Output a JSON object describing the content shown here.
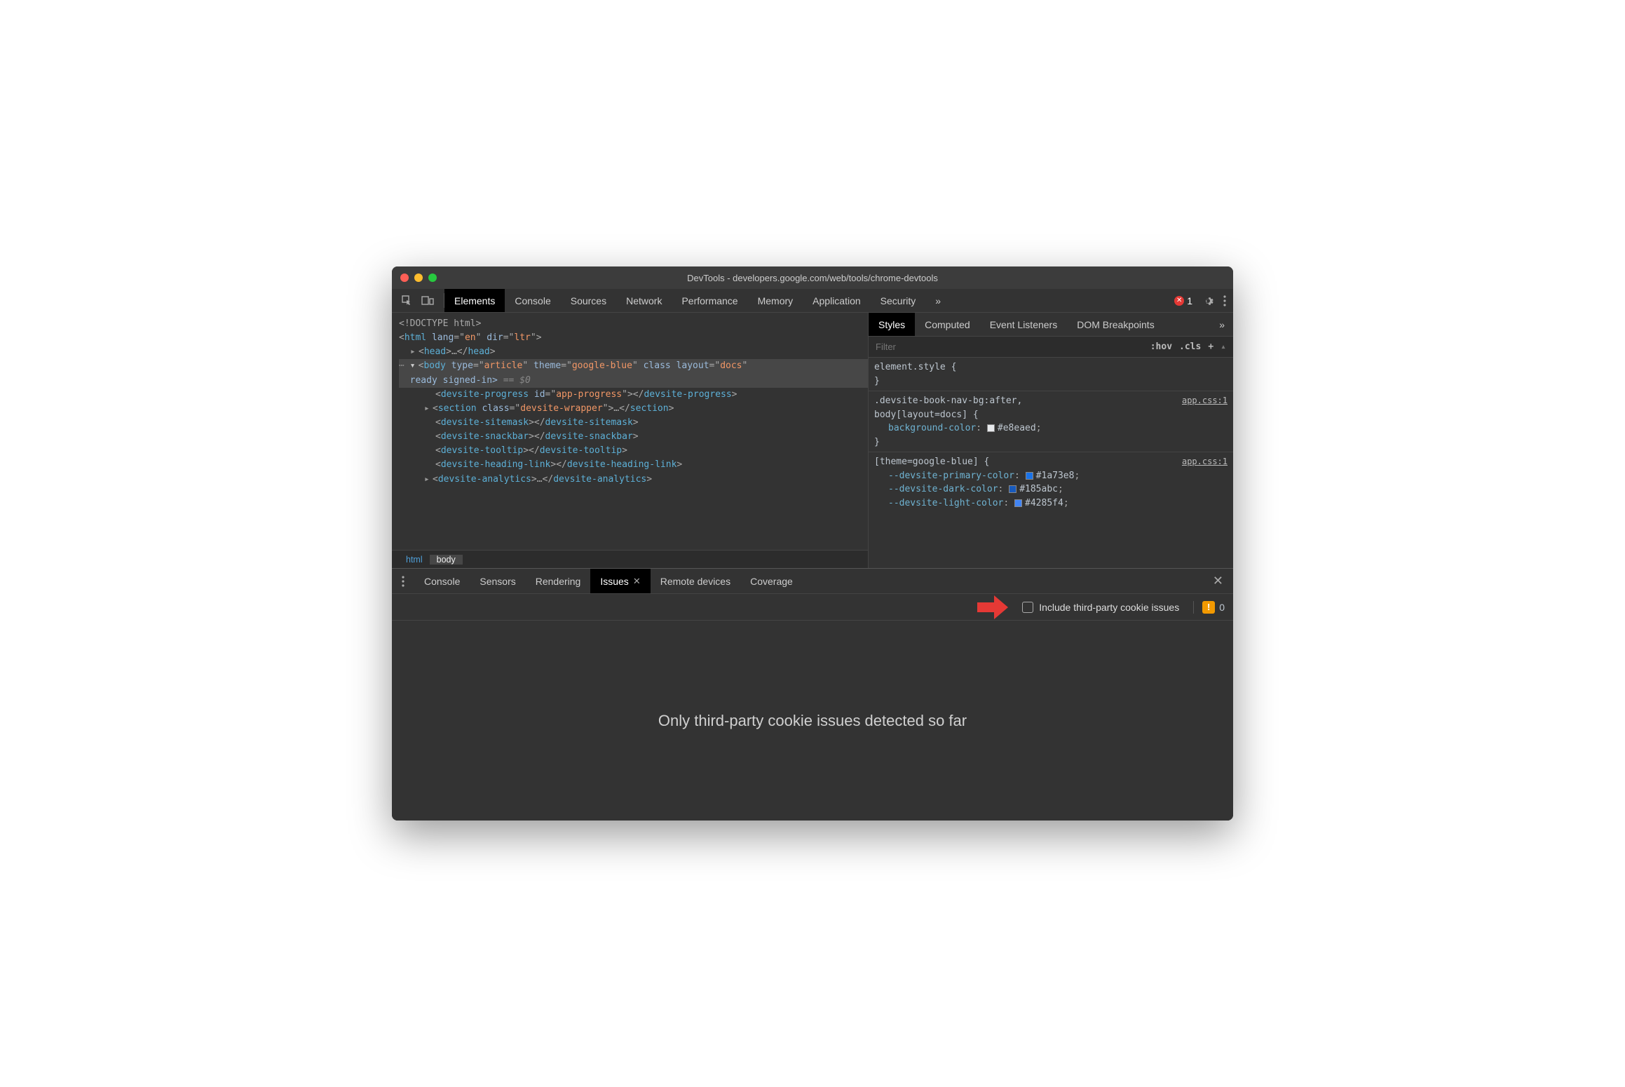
{
  "title": "DevTools - developers.google.com/web/tools/chrome-devtools",
  "toolbar": {
    "tabs": [
      "Elements",
      "Console",
      "Sources",
      "Network",
      "Performance",
      "Memory",
      "Application",
      "Security"
    ],
    "activeTab": "Elements",
    "errorCount": "1"
  },
  "dom": {
    "doctype": "<!DOCTYPE html>",
    "html_open": "<html lang=\"en\" dir=\"ltr\">",
    "head": "<head>…</head>",
    "body_attrs": {
      "type": "article",
      "theme": "google-blue",
      "layout": "docs",
      "tail": "ready signed-in>",
      "eq": " == $0"
    },
    "children": [
      "<devsite-progress id=\"app-progress\"></devsite-progress>",
      "<section class=\"devsite-wrapper\">…</section>",
      "<devsite-sitemask></devsite-sitemask>",
      "<devsite-snackbar></devsite-snackbar>",
      "<devsite-tooltip></devsite-tooltip>",
      "<devsite-heading-link></devsite-heading-link>",
      "<devsite-analytics>…</devsite-analytics>"
    ],
    "breadcrumb": [
      "html",
      "body"
    ]
  },
  "styles": {
    "tabs": [
      "Styles",
      "Computed",
      "Event Listeners",
      "DOM Breakpoints"
    ],
    "activeTab": "Styles",
    "filterPlaceholder": "Filter",
    "hov": ":hov",
    "cls": ".cls",
    "rules": [
      {
        "selector": "element.style {",
        "close": "}"
      },
      {
        "selector": ".devsite-book-nav-bg:after,",
        "selector2": "body[layout=docs] {",
        "src": "app.css:1",
        "props": [
          {
            "name": "background-color",
            "value": "#e8eaed",
            "swatch": "#e8eaed"
          }
        ],
        "close": "}"
      },
      {
        "selector": "[theme=google-blue] {",
        "src": "app.css:1",
        "props": [
          {
            "name": "--devsite-primary-color",
            "value": "#1a73e8",
            "swatch": "#1a73e8"
          },
          {
            "name": "--devsite-dark-color",
            "value": "#185abc",
            "swatch": "#185abc"
          },
          {
            "name": "--devsite-light-color",
            "value": "#4285f4",
            "swatch": "#4285f4"
          }
        ]
      }
    ]
  },
  "drawer": {
    "tabs": [
      "Console",
      "Sensors",
      "Rendering",
      "Issues",
      "Remote devices",
      "Coverage"
    ],
    "activeTab": "Issues",
    "checkboxLabel": "Include third-party cookie issues",
    "issueCount": "0",
    "emptyText": "Only third-party cookie issues detected so far"
  }
}
